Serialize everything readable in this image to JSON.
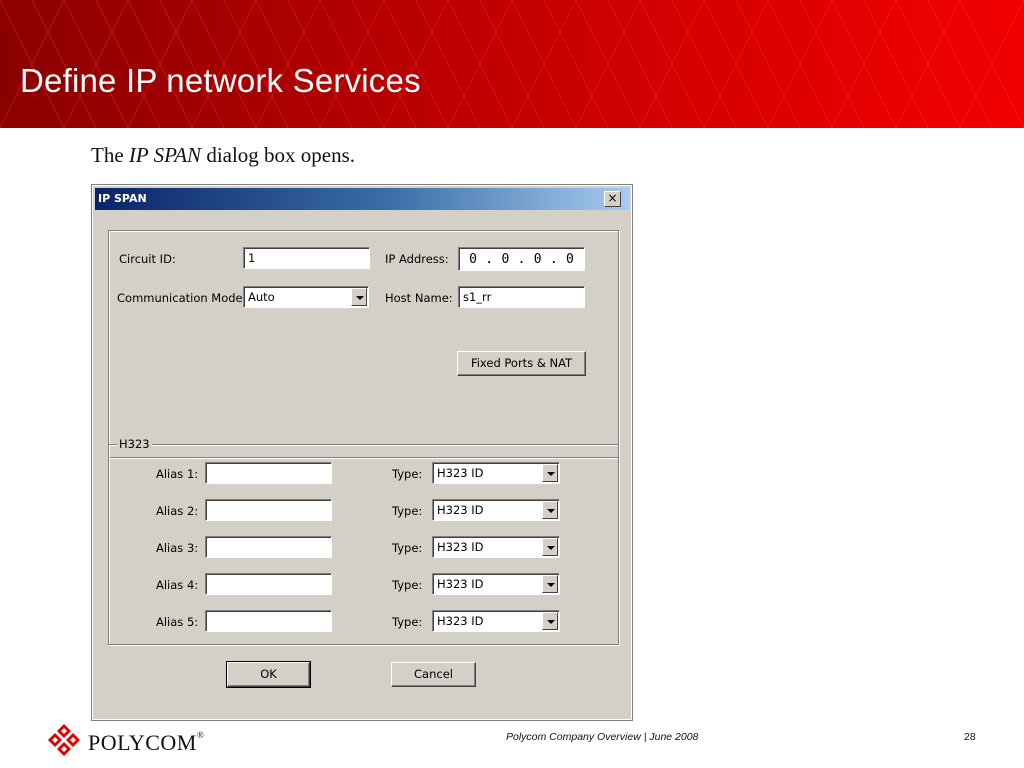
{
  "slide": {
    "title": "Define IP network Services",
    "caption_before": "The ",
    "caption_em": "IP SPAN",
    "caption_after": " dialog box opens.",
    "footer_text": "Polycom Company Overview | June 2008",
    "page_number": "28",
    "logo_text": "POLYCOM",
    "logo_mark": "®",
    "header_color": "#d40000"
  },
  "dialog": {
    "title": "IP SPAN",
    "close_label": "×",
    "circuit_id_label": "Circuit ID:",
    "circuit_id_value": "1",
    "ip_address_label": "IP Address:",
    "ip_address_octets": [
      "0",
      ".",
      "0",
      ".",
      "0",
      ".",
      "0"
    ],
    "comm_mode_label": "Communication Mode:",
    "comm_mode_value": "Auto",
    "host_name_label": "Host Name:",
    "host_name_value": "s1_rr",
    "fixed_ports_button": "Fixed Ports & NAT",
    "h323_legend": "H323",
    "aliases": [
      {
        "label": "Alias 1:",
        "value": "",
        "type_label": "Type:",
        "type_value": "H323 ID"
      },
      {
        "label": "Alias 2:",
        "value": "",
        "type_label": "Type:",
        "type_value": "H323 ID"
      },
      {
        "label": "Alias 3:",
        "value": "",
        "type_label": "Type:",
        "type_value": "H323 ID"
      },
      {
        "label": "Alias 4:",
        "value": "",
        "type_label": "Type:",
        "type_value": "H323 ID"
      },
      {
        "label": "Alias 5:",
        "value": "",
        "type_label": "Type:",
        "type_value": "H323 ID"
      }
    ],
    "ok_button": "OK",
    "cancel_button": "Cancel"
  }
}
